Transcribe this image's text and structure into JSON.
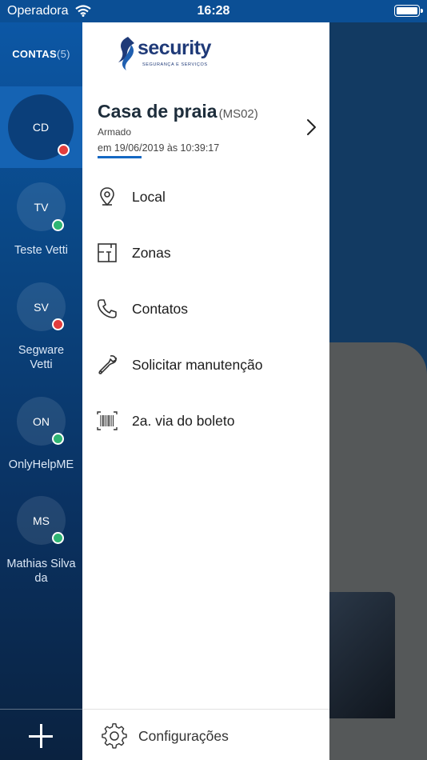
{
  "status_bar": {
    "carrier": "Operadora",
    "time": "16:28"
  },
  "accounts": {
    "title": "CONTAS",
    "count": "(5)",
    "items": [
      {
        "initials": "CD",
        "name": "",
        "status": "red",
        "active": true
      },
      {
        "initials": "TV",
        "name": "Teste Vetti",
        "status": "green",
        "active": false
      },
      {
        "initials": "SV",
        "name": "Segware Vetti",
        "status": "red",
        "active": false
      },
      {
        "initials": "ON",
        "name": "OnlyHelpME",
        "status": "green",
        "active": false
      },
      {
        "initials": "MS",
        "name": "Mathias Silva da",
        "status": "green",
        "active": false
      }
    ],
    "add_icon": "plus-icon"
  },
  "drawer": {
    "logo": {
      "word": "security",
      "tagline": "SEGURANÇA E SERVIÇOS"
    },
    "place": {
      "name": "Casa de praia",
      "code": "(MS02)",
      "status": "Armado",
      "date": "em 19/06/2019 às 10:39:17"
    },
    "menu": [
      {
        "label": "Local",
        "icon": "map-pin-icon"
      },
      {
        "label": "Zonas",
        "icon": "floor-plan-icon"
      },
      {
        "label": "Contatos",
        "icon": "phone-icon"
      },
      {
        "label": "Solicitar manutenção",
        "icon": "wrench-icon"
      },
      {
        "label": "2a. via do boleto",
        "icon": "barcode-icon"
      }
    ],
    "settings": {
      "label": "Configurações",
      "icon": "gear-icon"
    }
  },
  "colors": {
    "rail_top": "#0c57a5",
    "rail_active": "#1563b3",
    "status_red": "#e23d3d",
    "status_green": "#2fb573",
    "accent_underline": "#1468c3",
    "logo_blue": "#1f3a78"
  }
}
